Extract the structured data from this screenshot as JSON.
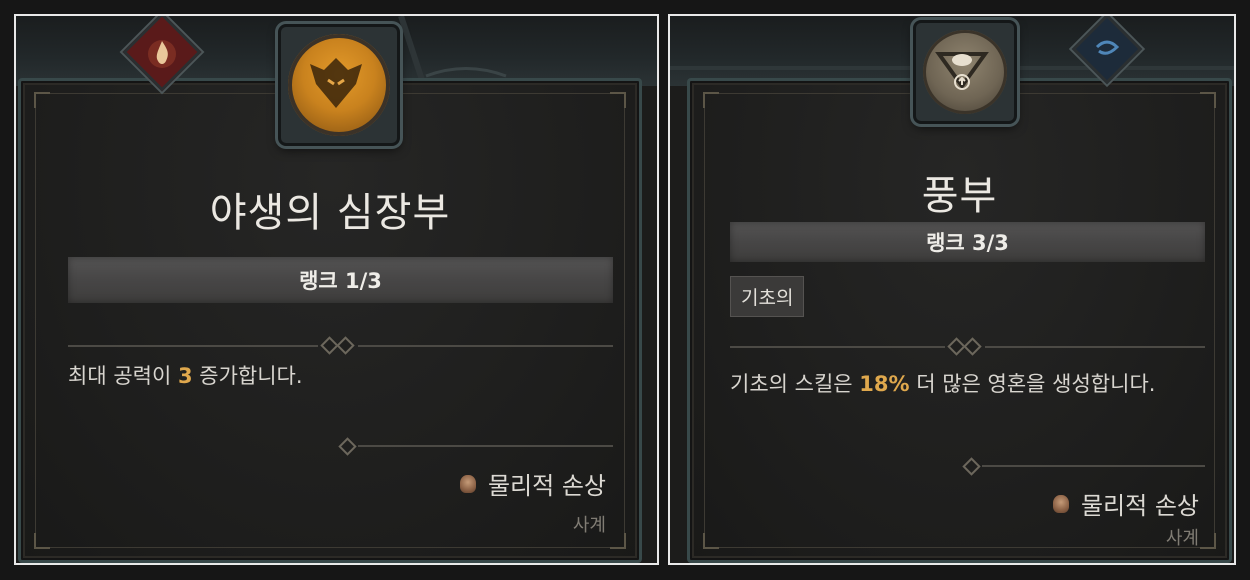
{
  "panels": [
    {
      "title": "야생의 심장부",
      "rank": "랭크 1/3",
      "description": {
        "prefix": "최대 공력이 ",
        "highlight": "3",
        "suffix": " 증가합니다."
      },
      "damage_type": "물리적 손상",
      "school": "사계",
      "icons": {
        "skill": "wolf-emblem-icon",
        "badge": "fire-badge-icon",
        "damage": "physical-damage-icon"
      },
      "colors": {
        "highlight": "#dfa84d",
        "skill_icon": "#c9821e"
      }
    },
    {
      "title": "풍부",
      "rank": "랭크 3/3",
      "tag": "기초의",
      "description": {
        "prefix": "기초의 스킬은 ",
        "highlight": "18%",
        "suffix": " 더 많은 영혼을 생성합니다."
      },
      "damage_type": "물리적 손상",
      "school": "사계",
      "icons": {
        "skill": "bowl-arrow-icon",
        "badge": "spirit-badge-icon",
        "damage": "physical-damage-icon"
      },
      "colors": {
        "highlight": "#dfa84d",
        "skill_icon": "#7a6f5d"
      }
    }
  ]
}
